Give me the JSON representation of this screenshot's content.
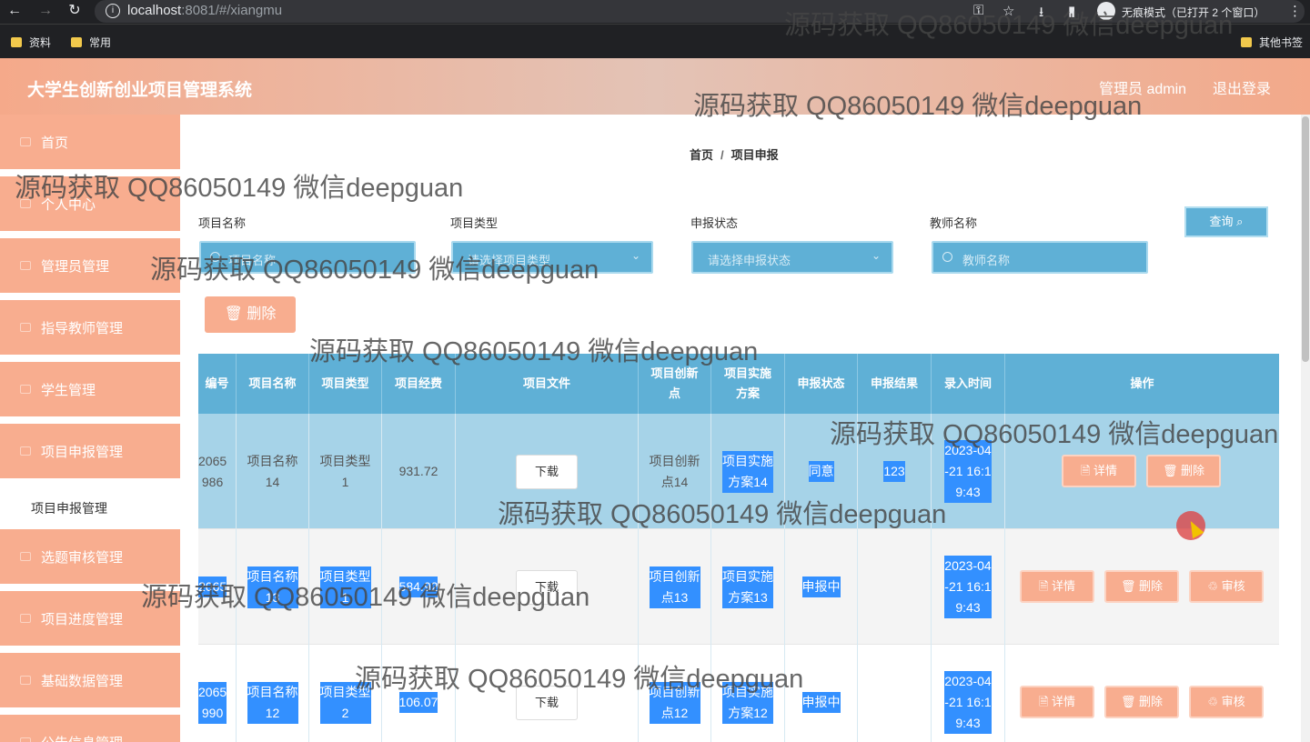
{
  "browser": {
    "url_host": "localhost",
    "url_rest": ":8081/#/xiangmu",
    "incognito_text": "无痕模式（已打开 2 个窗口）",
    "bookmarks": [
      "资料",
      "常用"
    ],
    "other_bookmarks": "其他书签"
  },
  "header": {
    "title": "大学生创新创业项目管理系统",
    "admin_label": "管理员 admin",
    "logout_label": "退出登录",
    "accent": "#f8ad8f"
  },
  "sidebar": {
    "items": [
      {
        "label": "首页"
      },
      {
        "label": "个人中心"
      },
      {
        "label": "管理员管理"
      },
      {
        "label": "指导教师管理"
      },
      {
        "label": "学生管理"
      },
      {
        "label": "项目申报管理"
      },
      {
        "label": "选题审核管理"
      },
      {
        "label": "项目进度管理"
      },
      {
        "label": "基础数据管理"
      },
      {
        "label": "公告信息管理"
      }
    ],
    "sub_item": "项目申报管理"
  },
  "breadcrumb": {
    "home": "首页",
    "sep": "/",
    "current": "项目申报"
  },
  "filters": {
    "project_name": {
      "label": "项目名称",
      "placeholder": "项目名称"
    },
    "project_type": {
      "label": "项目类型",
      "placeholder": "请选择项目类型"
    },
    "status": {
      "label": "申报状态",
      "placeholder": "请选择申报状态"
    },
    "teacher": {
      "label": "教师名称",
      "placeholder": "教师名称"
    },
    "query_label": "查询 ⌕",
    "delete_label": "🗑 删除"
  },
  "table": {
    "headers": [
      "编号",
      "项目名称",
      "项目类型",
      "项目经费",
      "项目文件",
      "项目创新点",
      "项目实施方案",
      "申报状态",
      "申报结果",
      "录入时间",
      "操作"
    ],
    "download_label": "下载",
    "detail_label": "🗎 详情",
    "remove_label": "🗑 删除",
    "review_label": "♲ 审核",
    "rows": [
      {
        "id": "2065\n986",
        "name": "项目名称\n14",
        "type": "项目类型\n1",
        "fund": "931.72",
        "innov": "项目创新\n点14",
        "plan": "项目实施\n方案14",
        "status": "同意",
        "result": "123",
        "time": "2023-04\n-21 16:1\n9:43"
      },
      {
        "id": "2065\n",
        "name": "项目名称\n13",
        "type": "项目类型\n1",
        "fund": "584.92",
        "innov": "项目创新\n点13",
        "plan": "项目实施\n方案13",
        "status": "申报中",
        "result": "",
        "time": "2023-04\n-21 16:1\n9:43"
      },
      {
        "id": "2065\n990",
        "name": "项目名称\n12",
        "type": "项目类型\n2",
        "fund": "106.07",
        "innov": "项目创新\n点12",
        "plan": "项目实施\n方案12",
        "status": "申报中",
        "result": "",
        "time": "2023-04\n-21 16:1\n9:43"
      }
    ]
  },
  "watermark": "源码获取 QQ86050149 微信deepguan"
}
